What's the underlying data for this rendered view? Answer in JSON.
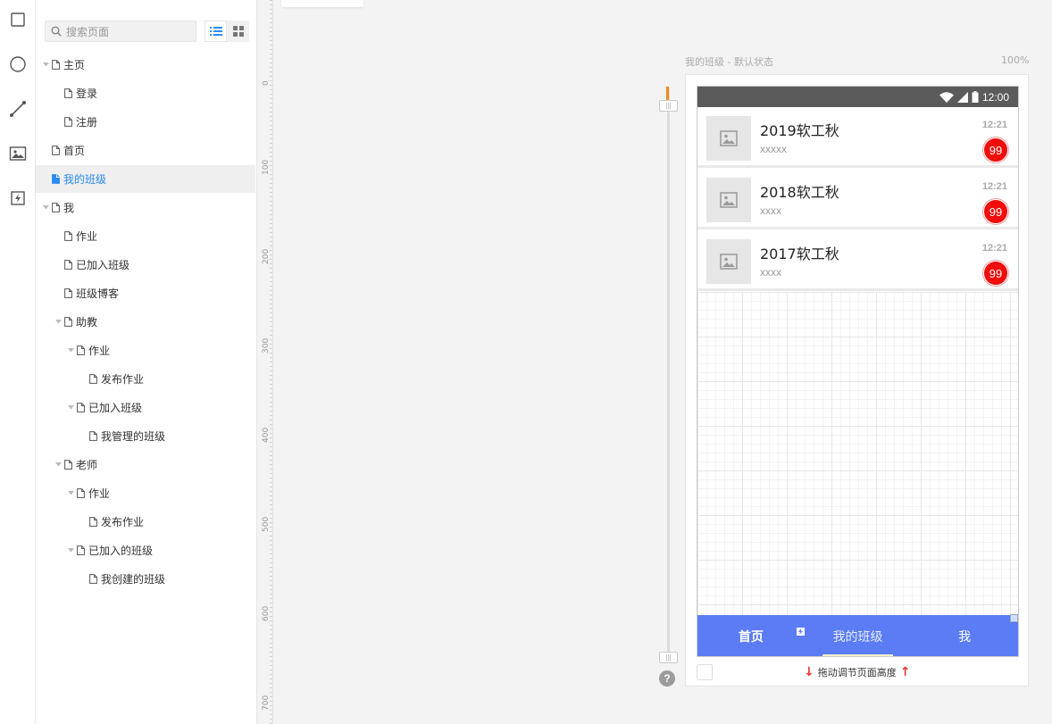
{
  "toolbar": {
    "tools": [
      {
        "name": "rectangle-tool",
        "icon": "square-icon"
      },
      {
        "name": "ellipse-tool",
        "icon": "circle-icon"
      },
      {
        "name": "line-tool",
        "icon": "line-icon"
      },
      {
        "name": "image-tool",
        "icon": "image-icon"
      },
      {
        "name": "hotspot-tool",
        "icon": "lightning-icon"
      }
    ]
  },
  "page_tree": {
    "search_placeholder": "搜索页面",
    "items": [
      {
        "label": "主页",
        "level": 0,
        "expandable": true
      },
      {
        "label": "登录",
        "level": 1,
        "expandable": false
      },
      {
        "label": "注册",
        "level": 1,
        "expandable": false
      },
      {
        "label": "首页",
        "level": 0,
        "expandable": false
      },
      {
        "label": "我的班级",
        "level": 0,
        "expandable": false,
        "selected": true
      },
      {
        "label": "我",
        "level": 0,
        "expandable": true
      },
      {
        "label": "作业",
        "level": 1,
        "expandable": false
      },
      {
        "label": "已加入班级",
        "level": 1,
        "expandable": false
      },
      {
        "label": "班级博客",
        "level": 1,
        "expandable": false
      },
      {
        "label": "助教",
        "level": 1,
        "expandable": true
      },
      {
        "label": "作业",
        "level": 2,
        "expandable": true
      },
      {
        "label": "发布作业",
        "level": 3,
        "expandable": false
      },
      {
        "label": "已加入班级",
        "level": 2,
        "expandable": true
      },
      {
        "label": "我管理的班级",
        "level": 3,
        "expandable": false
      },
      {
        "label": "老师",
        "level": 1,
        "expandable": true
      },
      {
        "label": "作业",
        "level": 2,
        "expandable": true
      },
      {
        "label": "发布作业",
        "level": 3,
        "expandable": false
      },
      {
        "label": "已加入的班级",
        "level": 2,
        "expandable": true
      },
      {
        "label": "我创建的班级",
        "level": 3,
        "expandable": false
      }
    ]
  },
  "ruler": {
    "labels": [
      "0",
      "100",
      "200",
      "300",
      "400",
      "500",
      "600",
      "700"
    ]
  },
  "canvas": {
    "frame_title": "我的班级 - 默认状态",
    "zoom": "100%",
    "status_time": "12:00",
    "cards": [
      {
        "title": "2019软工秋",
        "subtitle": "xxxxx",
        "time": "12:21",
        "badge": "99"
      },
      {
        "title": "2018软工秋",
        "subtitle": "xxxx",
        "time": "12:21",
        "badge": "99"
      },
      {
        "title": "2017软工秋",
        "subtitle": "xxxx",
        "time": "12:21",
        "badge": "99"
      }
    ],
    "tabs": [
      {
        "label": "首页",
        "active": false
      },
      {
        "label": "我的班级",
        "active": true
      },
      {
        "label": "我",
        "active": false
      }
    ],
    "resize_hint": "拖动调节页面高度",
    "help": "?"
  },
  "colors": {
    "accent": "#2a8bf2",
    "tabbar": "#5b7cf5",
    "badge": "#f20d0d",
    "statusbar": "#5b5b5b",
    "slider_marker": "#f08a1c"
  }
}
